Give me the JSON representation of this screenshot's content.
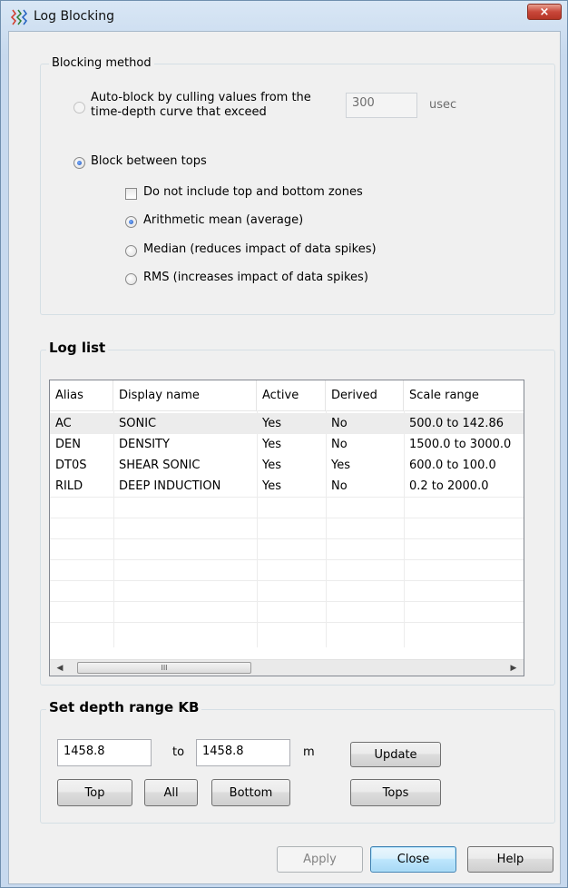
{
  "window": {
    "title": "Log Blocking"
  },
  "blocking": {
    "group_label": "Blocking method",
    "auto_block_line1": "Auto-block by culling values from the",
    "auto_block_line2": "time-depth curve that exceed",
    "threshold_value": "300",
    "threshold_unit": "usec",
    "between_tops_label": "Block between tops",
    "exclude_zones_label": "Do not include top and bottom zones",
    "mean_label": "Arithmetic mean (average)",
    "median_label": "Median (reduces impact of data spikes)",
    "rms_label": "RMS (increases impact of data spikes)"
  },
  "log_list": {
    "group_label": "Log list",
    "columns": [
      "Alias",
      "Display name",
      "Active",
      "Derived",
      "Scale range"
    ],
    "rows": [
      [
        "AC",
        "SONIC",
        "Yes",
        "No",
        "500.0 to 142.86"
      ],
      [
        "DEN",
        "DENSITY",
        "Yes",
        "No",
        "1500.0 to 3000.0"
      ],
      [
        "DT0S",
        "SHEAR SONIC",
        "Yes",
        "Yes",
        "600.0 to 100.0"
      ],
      [
        "RILD",
        "DEEP INDUCTION",
        "Yes",
        "No",
        "0.2 to 2000.0"
      ]
    ],
    "scroll_grip": "III"
  },
  "depth": {
    "group_label": "Set depth range KB",
    "from_value": "1458.8",
    "to_label": "to",
    "to_value": "1458.8",
    "unit": "m",
    "update_label": "Update",
    "top_label": "Top",
    "all_label": "All",
    "bottom_label": "Bottom",
    "tops_label": "Tops"
  },
  "footer": {
    "apply_label": "Apply",
    "close_label": "Close",
    "help_label": "Help"
  },
  "icons": {
    "close": "×",
    "scroll_left": "◀",
    "scroll_right": "▶"
  }
}
